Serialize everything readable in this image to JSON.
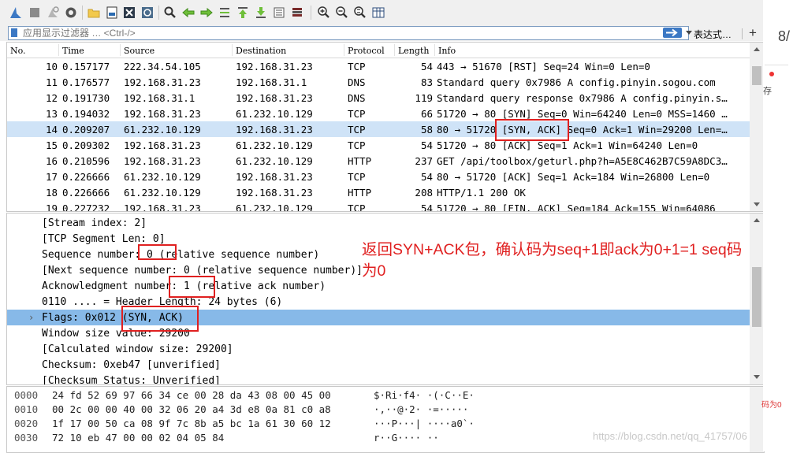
{
  "toolbar": {
    "icons": [
      "shark-fin-start-icon",
      "stop-square-icon",
      "restart-capture-icon",
      "capture-options-gear-icon",
      "open-folder-icon",
      "save-file-icon",
      "close-file-icon",
      "reload-icon",
      "find-magnifier-icon",
      "go-back-arrow-icon",
      "go-forward-arrow-icon",
      "go-to-packet-icon",
      "go-first-icon",
      "go-last-icon",
      "autoscroll-icon",
      "colorize-icon",
      "zoom-in-icon",
      "zoom-out-icon",
      "zoom-normal-icon",
      "resize-columns-icon"
    ]
  },
  "filter": {
    "placeholder": "应用显示过滤器 … <Ctrl-/>",
    "expression_label": "表达式…",
    "add_label": "+"
  },
  "packet_list": {
    "columns": [
      "No.",
      "Time",
      "Source",
      "Destination",
      "Protocol",
      "Length",
      "Info"
    ],
    "rows": [
      {
        "no": "10",
        "time": "0.157177",
        "src": "222.34.54.105",
        "dst": "192.168.31.23",
        "proto": "TCP",
        "len": "54",
        "info": "443 → 51670 [RST] Seq=24 Win=0 Len=0"
      },
      {
        "no": "11",
        "time": "0.176577",
        "src": "192.168.31.23",
        "dst": "192.168.31.1",
        "proto": "DNS",
        "len": "83",
        "info": "Standard query 0x7986 A config.pinyin.sogou.com"
      },
      {
        "no": "12",
        "time": "0.191730",
        "src": "192.168.31.1",
        "dst": "192.168.31.23",
        "proto": "DNS",
        "len": "119",
        "info": "Standard query response 0x7986 A config.pinyin.s…"
      },
      {
        "no": "13",
        "time": "0.194032",
        "src": "192.168.31.23",
        "dst": "61.232.10.129",
        "proto": "TCP",
        "len": "66",
        "info": "51720 → 80 [SYN] Seq=0 Win=64240 Len=0 MSS=1460 …"
      },
      {
        "no": "14",
        "time": "0.209207",
        "src": "61.232.10.129",
        "dst": "192.168.31.23",
        "proto": "TCP",
        "len": "58",
        "info": "80 → 51720 [SYN, ACK] Seq=0 Ack=1 Win=29200 Len=…"
      },
      {
        "no": "15",
        "time": "0.209302",
        "src": "192.168.31.23",
        "dst": "61.232.10.129",
        "proto": "TCP",
        "len": "54",
        "info": "51720 → 80 [ACK] Seq=1 Ack=1 Win=64240 Len=0"
      },
      {
        "no": "16",
        "time": "0.210596",
        "src": "192.168.31.23",
        "dst": "61.232.10.129",
        "proto": "HTTP",
        "len": "237",
        "info": "GET /api/toolbox/geturl.php?h=A5E8C462B7C59A8DC3…"
      },
      {
        "no": "17",
        "time": "0.226666",
        "src": "61.232.10.129",
        "dst": "192.168.31.23",
        "proto": "TCP",
        "len": "54",
        "info": "80 → 51720 [ACK] Seq=1 Ack=184 Win=26800 Len=0"
      },
      {
        "no": "18",
        "time": "0.226666",
        "src": "61.232.10.129",
        "dst": "192.168.31.23",
        "proto": "HTTP",
        "len": "208",
        "info": "HTTP/1.1 200 OK"
      },
      {
        "no": "19",
        "time": "0.227232",
        "src": "192.168.31.23",
        "dst": "61.232.10.129",
        "proto": "TCP",
        "len": "54",
        "info": "51720 → 80 [FIN, ACK] Seq=184 Ack=155 Win=64086"
      }
    ],
    "selected_no": "14"
  },
  "details": {
    "lines": [
      "[Stream index: 2]",
      "[TCP Segment Len: 0]",
      "Sequence number: 0    (relative sequence number)",
      "[Next sequence number: 0    (relative sequence number)]",
      "Acknowledgment number: 1    (relative ack number)",
      "0110 .... = Header Length: 24 bytes (6)",
      "Flags: 0x012 (SYN, ACK)",
      "Window size value: 29200",
      "[Calculated window size: 29200]",
      "Checksum: 0xeb47 [unverified]",
      "[Checksum Status: Unverified]"
    ],
    "expander": "›"
  },
  "bytes": {
    "lines": [
      {
        "offset": "0000",
        "hex": "24 fd 52 69 97 66 34 ce  00 28 da 43 08 00 45 00",
        "ascii": "$·Ri·f4·  ·(·C··E·"
      },
      {
        "offset": "0010",
        "hex": "00 2c 00 00 40 00 32 06  20 a4 3d e8 0a 81 c0 a8",
        "ascii": "·,··@·2·   ·=·····"
      },
      {
        "offset": "0020",
        "hex": "1f 17 00 50 ca 08 9f 7c  8b a5 bc 1a 61 30 60 12",
        "ascii": "···P···|  ····a0`·"
      },
      {
        "offset": "0030",
        "hex": "72 10 eb 47 00 00 02 04  05 84",
        "ascii": "r··G····  ··"
      }
    ]
  },
  "annotation": {
    "text": "返回SYN+ACK包，确认码为seq+1即ack为0+1=1 seq码为0",
    "color": "#e02020"
  },
  "right_gutter": {
    "top_text": "8/",
    "mid_text": "存",
    "bottom_text": "码为0"
  },
  "watermark": "https://blog.csdn.net/qq_41757/06"
}
